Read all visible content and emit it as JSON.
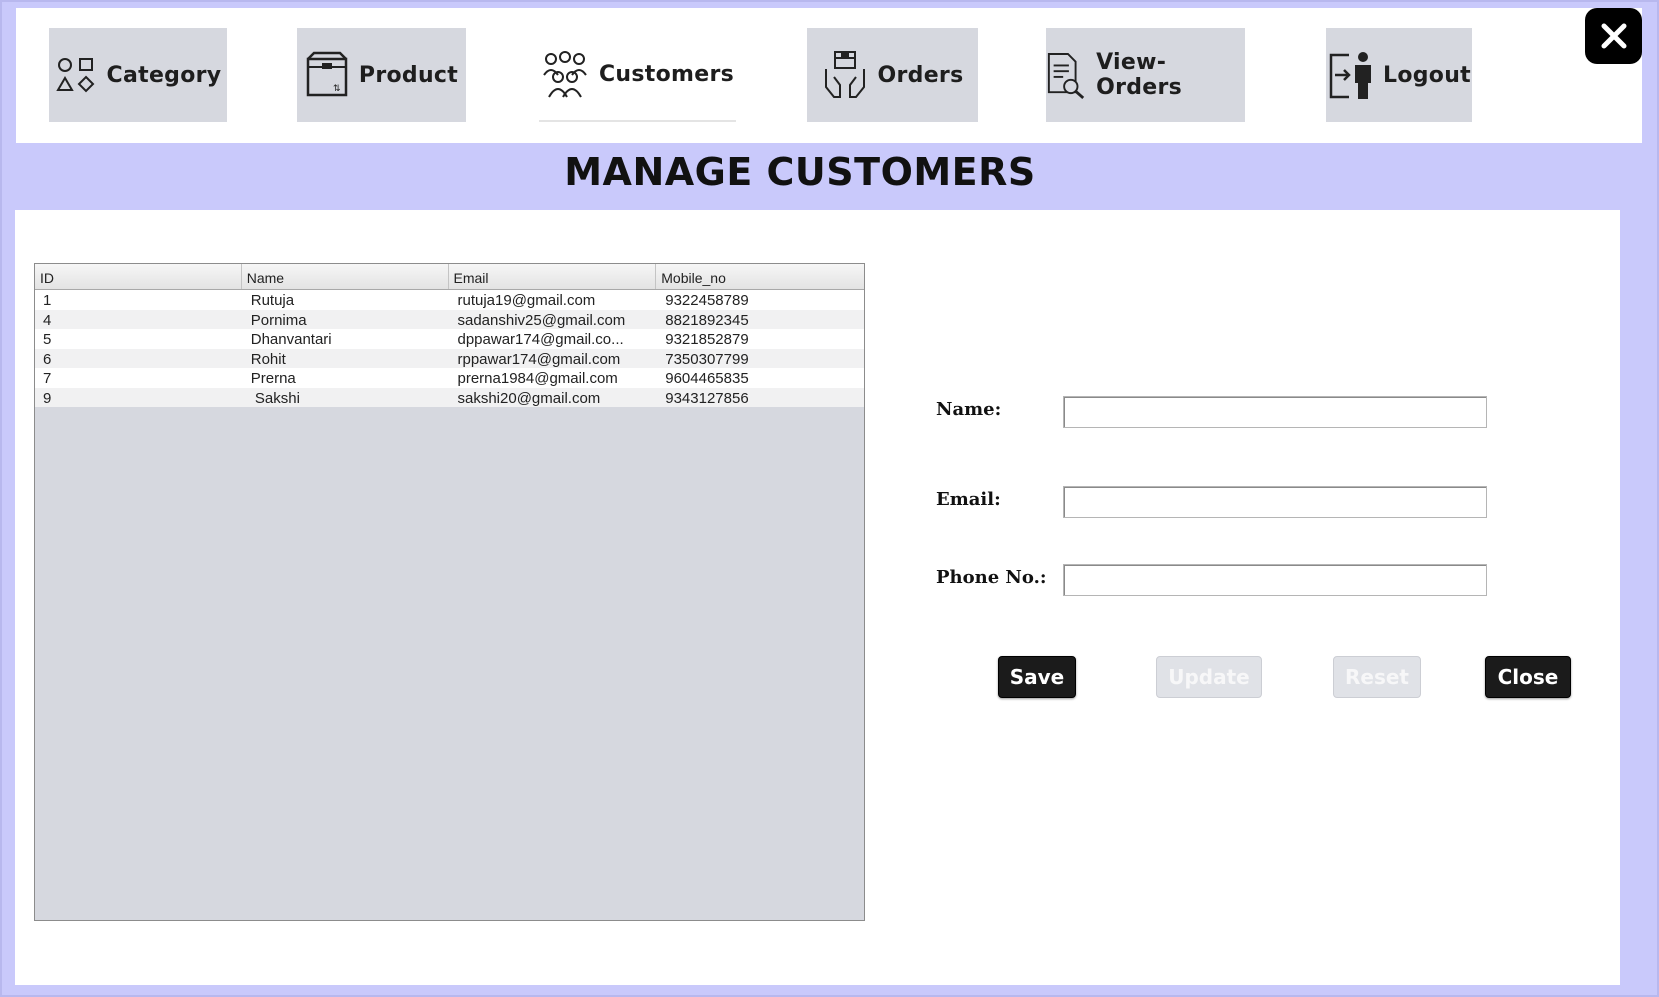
{
  "nav": {
    "items": [
      {
        "label": "Category",
        "icon": "shapes-icon"
      },
      {
        "label": "Product",
        "icon": "box-icon"
      },
      {
        "label": "Customers",
        "icon": "people-icon"
      },
      {
        "label": "Orders",
        "icon": "delivery-hands-icon"
      },
      {
        "label": "View-Orders",
        "icon": "document-search-icon"
      },
      {
        "label": "Logout",
        "icon": "logout-door-icon"
      }
    ],
    "active": "Customers",
    "close_icon": "close-icon"
  },
  "page": {
    "title": "MANAGE CUSTOMERS"
  },
  "table": {
    "columns": [
      "ID",
      "Name",
      "Email",
      "Mobile_no"
    ],
    "rows": [
      [
        "1",
        "Rutuja",
        "rutuja19@gmail.com",
        "9322458789"
      ],
      [
        "4",
        "Pornima",
        "sadanshiv25@gmail.com",
        "8821892345"
      ],
      [
        "5",
        "Dhanvantari",
        "dppawar174@gmail.co...",
        "9321852879"
      ],
      [
        "6",
        "Rohit",
        "rppawar174@gmail.com",
        "7350307799"
      ],
      [
        "7",
        "Prerna",
        "prerna1984@gmail.com",
        "9604465835"
      ],
      [
        "9",
        " Sakshi",
        "sakshi20@gmail.com",
        "9343127856"
      ]
    ]
  },
  "form": {
    "name_label": "Name:",
    "email_label": "Email:",
    "phone_label": "Phone No.:",
    "name_value": "",
    "email_value": "",
    "phone_value": ""
  },
  "buttons": {
    "save": "Save",
    "update": "Update",
    "reset": "Reset",
    "close": "Close"
  },
  "colors": {
    "background": "#c9c9fb",
    "nav_button": "#d6d8df",
    "dark_button": "#1b1b1b",
    "disabled_button": "#e0e2e7"
  }
}
